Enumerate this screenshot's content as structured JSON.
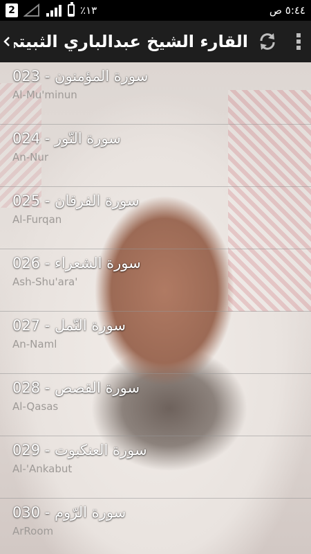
{
  "status_bar": {
    "time": "٥:٤٤ ص",
    "battery_percent": "٪١٣",
    "battery_level": 0.13,
    "notification_count": "2"
  },
  "action_bar": {
    "title": "القارء الشيخ عبدالباري الثبيتي",
    "icons": [
      "chevron-back-icon",
      "refresh-icon",
      "overflow-menu-icon"
    ]
  },
  "surahs": [
    {
      "number": "023",
      "arabic": "سورة المؤمنون",
      "english": "Al-Mu'minun"
    },
    {
      "number": "024",
      "arabic": "سورة النّور",
      "english": "An-Nur"
    },
    {
      "number": "025",
      "arabic": "سورة الفرقان",
      "english": "Al-Furqan"
    },
    {
      "number": "026",
      "arabic": "سورة الشعراء",
      "english": "Ash-Shu'ara'"
    },
    {
      "number": "027",
      "arabic": "سورة النّمل",
      "english": "An-Naml"
    },
    {
      "number": "028",
      "arabic": "سورة القصص",
      "english": "Al-Qasas"
    },
    {
      "number": "029",
      "arabic": "سورة العنكبوت",
      "english": "Al-'Ankabut"
    },
    {
      "number": "030",
      "arabic": "سورة الرّوم",
      "english": "ArRoom"
    }
  ],
  "colors": {
    "action_bar_bg": "#1e1e1e",
    "title_text": "#ffffff",
    "subtitle_text": "#9e9a97"
  }
}
